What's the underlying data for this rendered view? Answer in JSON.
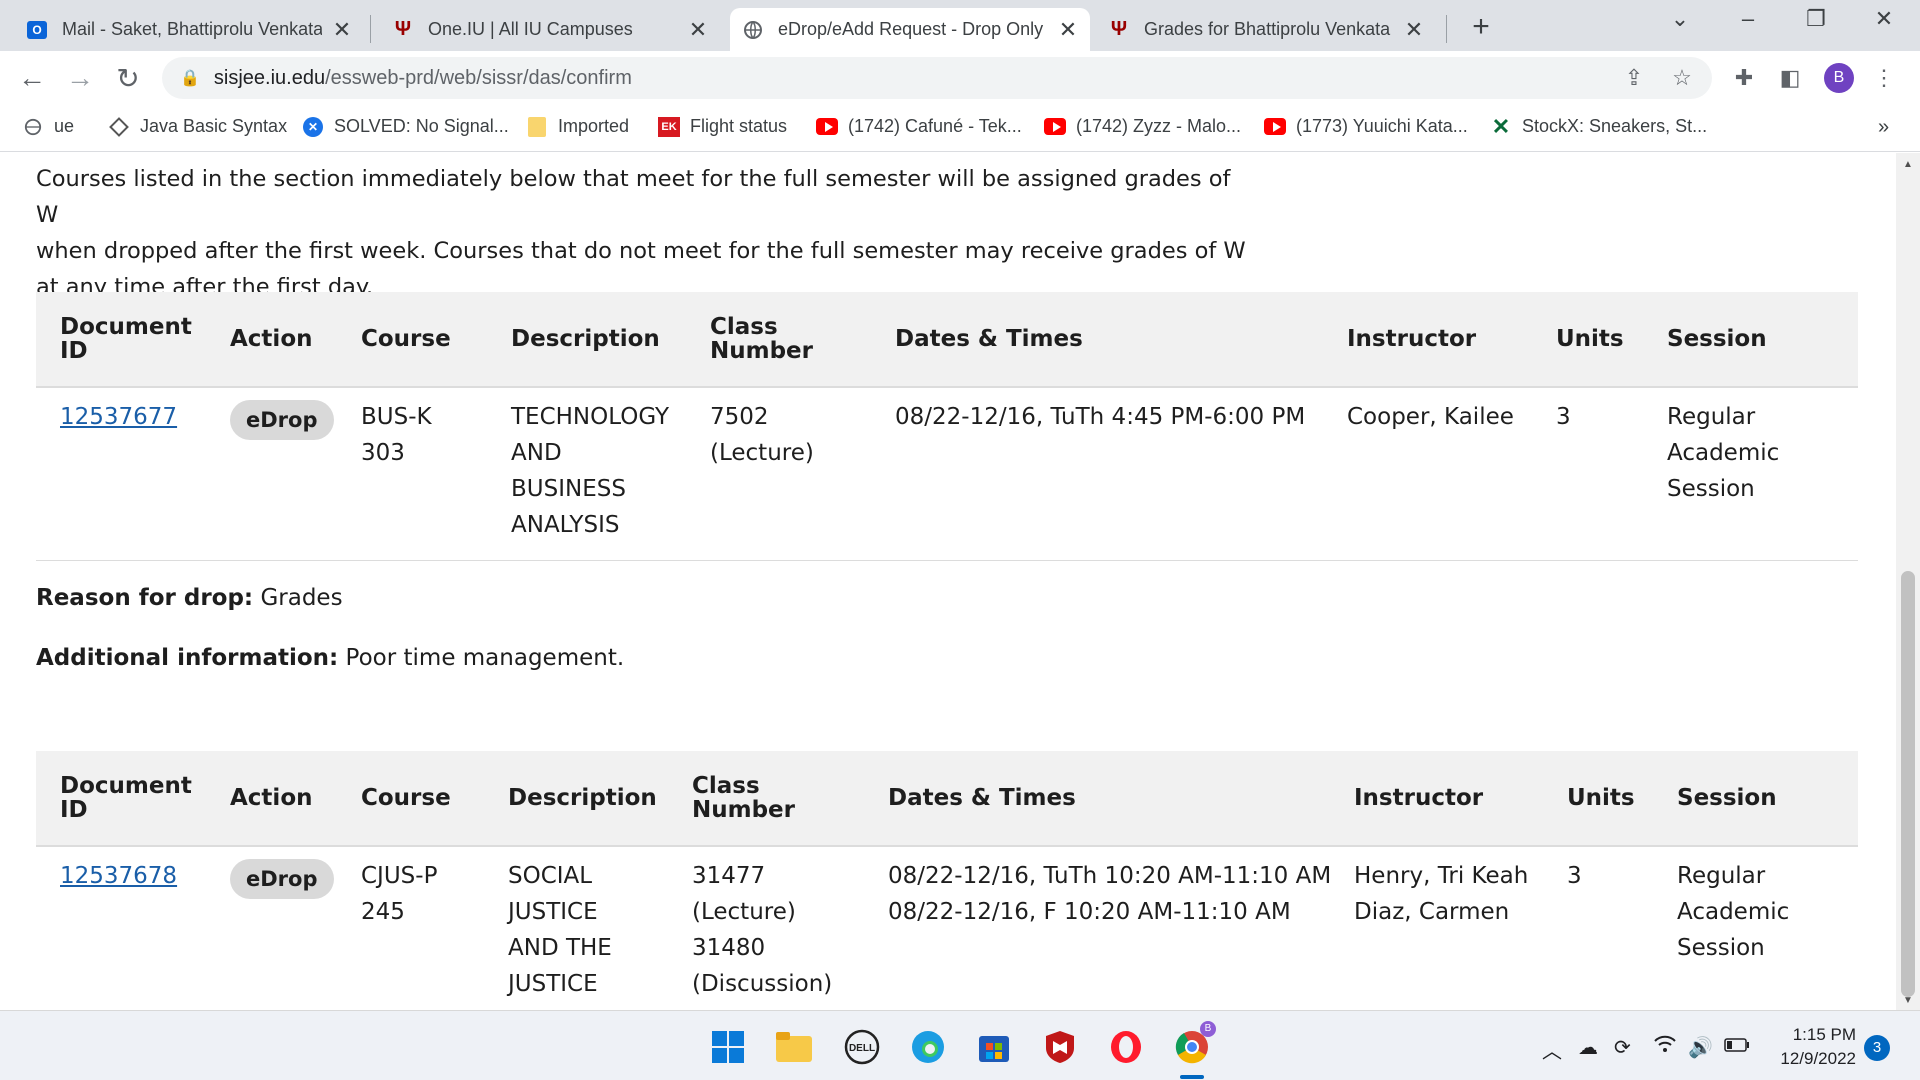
{
  "tabs": [
    {
      "title": "Mail - Saket, Bhattiprolu Venkata",
      "icon": "outlook-icon"
    },
    {
      "title": "One.IU | All IU Campuses",
      "icon": "iu-trident-icon"
    },
    {
      "title": "eDrop/eAdd Request - Drop Only",
      "icon": "globe-icon"
    },
    {
      "title": "Grades for Bhattiprolu Venkata S",
      "icon": "iu-trident-icon"
    }
  ],
  "address": {
    "host": "sisjee.iu.edu",
    "path": "/essweb-prd/web/sissr/das/confirm"
  },
  "profile_initial": "B",
  "bookmarks": [
    {
      "label": "ue"
    },
    {
      "label": "Java Basic Syntax"
    },
    {
      "label": "SOLVED: No Signal..."
    },
    {
      "label": "Imported"
    },
    {
      "label": "Flight status",
      "badge": "EK"
    },
    {
      "label": "(1742) Cafuné - Tek..."
    },
    {
      "label": "(1742) Zyzz - Malo..."
    },
    {
      "label": "(1773) Yuuichi Kata..."
    },
    {
      "label": "StockX: Sneakers, St..."
    }
  ],
  "intro": {
    "line1": "Courses listed in the section immediately below that meet for the full semester will be assigned grades of W",
    "line2": "when dropped after the first week. Courses that do not meet for the full semester may receive grades of W",
    "line3": "at any time after the first day."
  },
  "headers": {
    "doc1": "Document",
    "doc2": "ID",
    "action": "Action",
    "course": "Course",
    "description": "Description",
    "class1": "Class",
    "class2": "Number",
    "dates": "Dates & Times",
    "instructor": "Instructor",
    "units": "Units",
    "session": "Session"
  },
  "rows": [
    {
      "doc_id": "12537677",
      "action": "eDrop",
      "course": [
        "BUS-K",
        "303"
      ],
      "description": [
        "TECHNOLOGY",
        "AND",
        "BUSINESS",
        "ANALYSIS"
      ],
      "class_number": [
        "7502",
        "(Lecture)"
      ],
      "dates": [
        "08/22-12/16, TuTh 4:45 PM-6:00 PM"
      ],
      "instructor": [
        "Cooper, Kailee"
      ],
      "units": "3",
      "session": [
        "Regular",
        "Academic",
        "Session"
      ]
    },
    {
      "doc_id": "12537678",
      "action": "eDrop",
      "course": [
        "CJUS-P",
        "245"
      ],
      "description": [
        "SOCIAL",
        "JUSTICE",
        "AND THE",
        "JUSTICE"
      ],
      "class_number": [
        "31477",
        "(Lecture)",
        "31480",
        "(Discussion)"
      ],
      "dates": [
        "08/22-12/16, TuTh 10:20 AM-11:10 AM",
        "08/22-12/16, F 10:20 AM-11:10 AM"
      ],
      "instructor": [
        "Henry, Tri Keah",
        "Diaz, Carmen"
      ],
      "units": "3",
      "session": [
        "Regular",
        "Academic",
        "Session"
      ]
    }
  ],
  "reason": {
    "label": "Reason for drop:",
    "value": "Grades"
  },
  "additional": {
    "label": "Additional information:",
    "value": "Poor time management."
  },
  "taskbar": {
    "time": "1:15 PM",
    "date": "12/9/2022",
    "notifications": "3"
  },
  "colors": {
    "accent_link": "#1a5ea8",
    "iu_crimson": "#990000",
    "header_bg": "#f1f1f1"
  }
}
